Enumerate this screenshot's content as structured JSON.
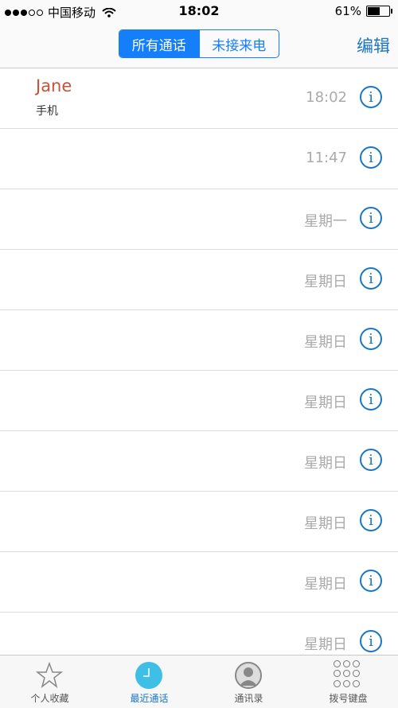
{
  "status": {
    "carrier": "中国移动",
    "time": "18:02",
    "battery": "61%",
    "battery_fraction": 0.61
  },
  "nav": {
    "segments": [
      {
        "label": "所有通话",
        "active": true
      },
      {
        "label": "未接来电",
        "active": false
      }
    ],
    "edit_label": "编辑"
  },
  "calls": [
    {
      "name": "Jane",
      "type": "手机",
      "when": "18:02"
    },
    {
      "name": "",
      "type": "",
      "when": "11:47"
    },
    {
      "name": "",
      "type": "",
      "when": "星期一"
    },
    {
      "name": "",
      "type": "",
      "when": "星期日"
    },
    {
      "name": "",
      "type": "",
      "when": "星期日"
    },
    {
      "name": "",
      "type": "",
      "when": "星期日"
    },
    {
      "name": "",
      "type": "",
      "when": "星期日"
    },
    {
      "name": "",
      "type": "",
      "when": "星期日"
    },
    {
      "name": "",
      "type": "",
      "when": "星期日"
    },
    {
      "name": "",
      "type": "",
      "when": "星期日"
    }
  ],
  "tabs": [
    {
      "label": "个人收藏",
      "icon": "star-icon"
    },
    {
      "label": "最近通话",
      "icon": "clock-icon",
      "active": true
    },
    {
      "label": "通讯录",
      "icon": "contacts-icon"
    },
    {
      "label": "拨号键盘",
      "icon": "keypad-icon"
    }
  ],
  "colors": {
    "accent": "#147efb",
    "missed_red": "#c4533b"
  }
}
